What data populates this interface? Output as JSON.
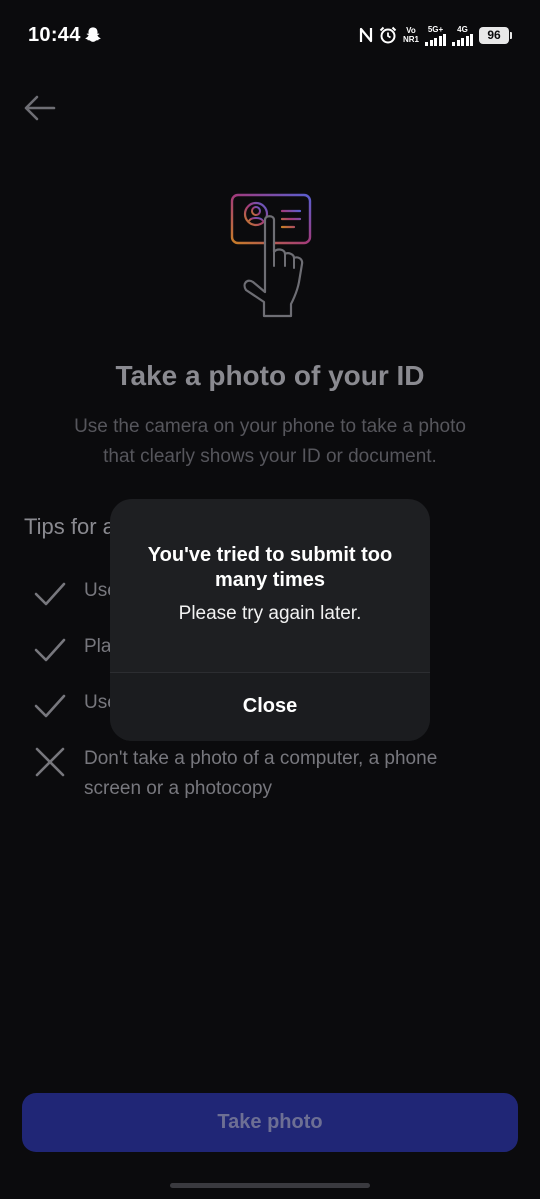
{
  "status_bar": {
    "time": "10:44",
    "vo_top": "Vo",
    "vo_bottom": "NR1",
    "net1": "5G+",
    "net2": "4G",
    "battery": "96"
  },
  "page": {
    "title": "Take a photo of your ID",
    "description": "Use the camera on your phone to take a photo that clearly shows your ID or document.",
    "tips_heading": "Tips for a",
    "tips": [
      {
        "text": "Use",
        "icon": "check-icon"
      },
      {
        "text": "Pla",
        "icon": "check-icon"
      },
      {
        "text": "Use",
        "icon": "check-icon"
      },
      {
        "text": "Don't take a photo of a computer, a phone screen or a photocopy",
        "icon": "cross-icon"
      }
    ],
    "primary_button": "Take photo"
  },
  "dialog": {
    "title": "You've tried to submit too many times",
    "message": "Please try again later.",
    "close_label": "Close"
  },
  "colors": {
    "background": "#0b0b0d",
    "dialog_bg": "#1e1f22",
    "button_bg": "#202676",
    "button_text": "#6d6f94"
  }
}
